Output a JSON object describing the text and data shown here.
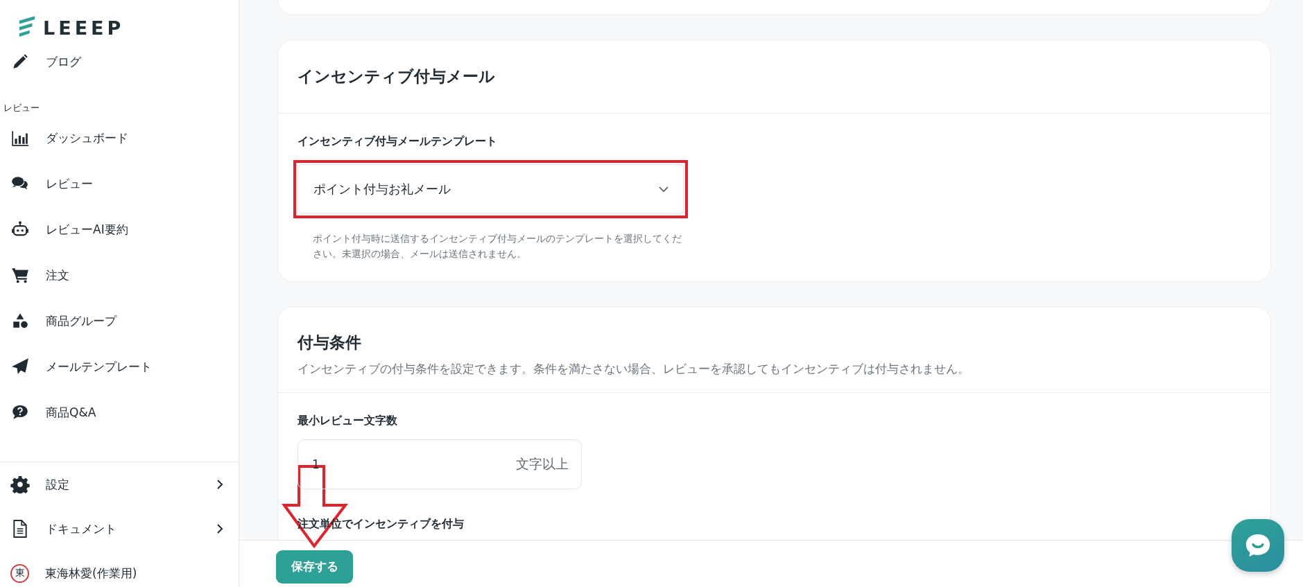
{
  "logo": {
    "text": "LEEEP"
  },
  "sidebar": {
    "top_items": [
      {
        "label": "ブログ",
        "kind": "pencil"
      }
    ],
    "section_label": "レビュー",
    "items": [
      {
        "label": "ダッシュボード",
        "kind": "chart"
      },
      {
        "label": "レビュー",
        "kind": "chat"
      },
      {
        "label": "レビューAI要約",
        "kind": "robot"
      },
      {
        "label": "注文",
        "kind": "cart"
      },
      {
        "label": "商品グループ",
        "kind": "shapes"
      },
      {
        "label": "メールテンプレート",
        "kind": "plane"
      },
      {
        "label": "商品Q&A",
        "kind": "question"
      }
    ],
    "bottom_items": [
      {
        "label": "設定",
        "kind": "gear",
        "has_submenu": true
      },
      {
        "label": "ドキュメント",
        "kind": "document",
        "has_submenu": true
      }
    ],
    "user": {
      "initial": "東",
      "name": "東海林愛(作業用)"
    }
  },
  "incentive_mail": {
    "title": "インセンティブ付与メール",
    "field": {
      "label": "インセンティブ付与メールテンプレート",
      "value": "ポイント付与お礼メール",
      "hint": "ポイント付与時に送信するインセンティブ付与メールのテンプレートを選択してください。未選択の場合、メールは送信されません。"
    }
  },
  "conditions": {
    "title": "付与条件",
    "description": "インセンティブの付与条件を設定できます。条件を満たさない場合、レビューを承認してもインセンティブは付与されません。",
    "fields": [
      {
        "label": "最小レビュー文字数",
        "value": "1",
        "suffix": "文字以上"
      }
    ],
    "next_label": "注文単位でインセンティブを付与"
  },
  "save_button": {
    "label": "保存する"
  }
}
